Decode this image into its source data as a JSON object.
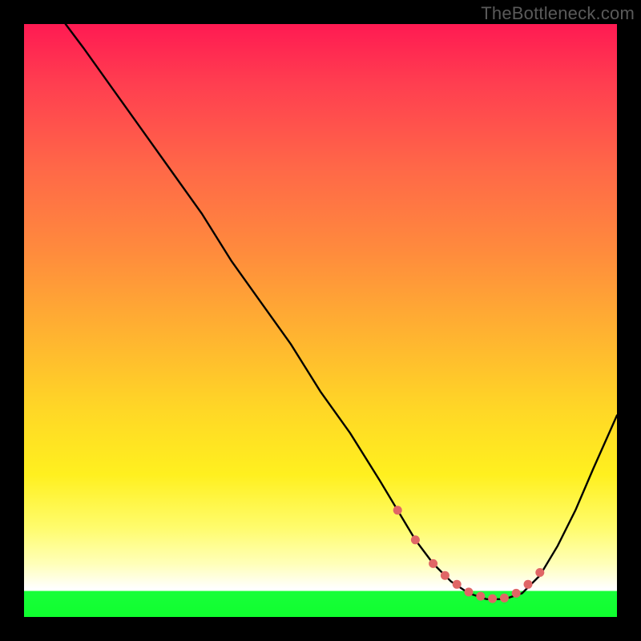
{
  "watermark": "TheBottleneck.com",
  "colors": {
    "frame": "#000000",
    "gradient_top": "#ff1a52",
    "gradient_mid1": "#ff8a3d",
    "gradient_mid2": "#ffd726",
    "gradient_low": "#ffffb8",
    "gradient_white": "#ffffff",
    "gradient_green": "#18ff3a",
    "line": "#000000",
    "dot": "#e06666"
  },
  "chart_data": {
    "type": "line",
    "title": "",
    "xlabel": "",
    "ylabel": "",
    "xlim": [
      0,
      100
    ],
    "ylim": [
      0,
      100
    ],
    "series": [
      {
        "name": "curve",
        "x": [
          7,
          10,
          15,
          20,
          25,
          30,
          35,
          40,
          45,
          50,
          55,
          60,
          63,
          66,
          69,
          72,
          75,
          78,
          81,
          84,
          87,
          90,
          93,
          96,
          100
        ],
        "y": [
          100,
          96,
          89,
          82,
          75,
          68,
          60,
          53,
          46,
          38,
          31,
          23,
          18,
          13,
          9,
          6,
          4,
          3,
          3,
          4,
          7,
          12,
          18,
          25,
          34
        ]
      }
    ],
    "dots": {
      "name": "highlight-dots",
      "x": [
        63,
        66,
        69,
        71,
        73,
        75,
        77,
        79,
        81,
        83,
        85,
        87
      ],
      "y": [
        18,
        13,
        9,
        7,
        5.5,
        4.2,
        3.5,
        3.1,
        3.2,
        4,
        5.5,
        7.5
      ]
    }
  }
}
